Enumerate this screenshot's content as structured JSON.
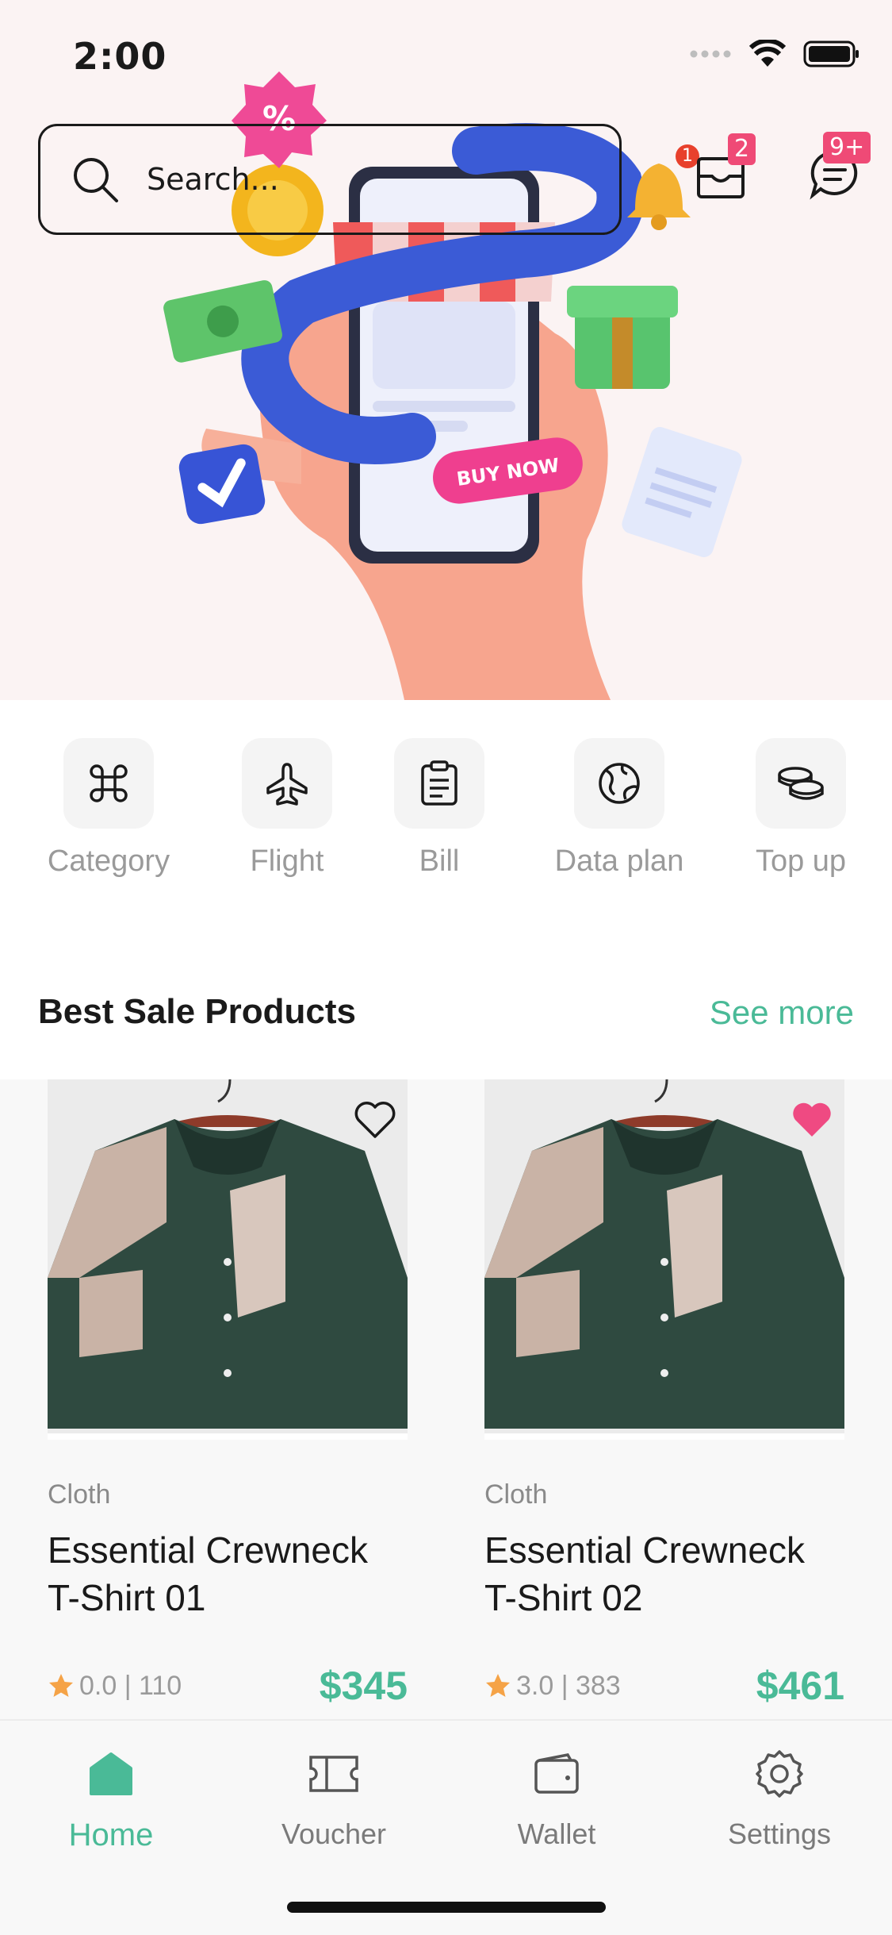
{
  "status_bar": {
    "time": "2:00"
  },
  "search": {
    "placeholder": "Search..."
  },
  "header_badges": {
    "notifications": "1",
    "inbox": "2",
    "messages": "9+"
  },
  "banner": {
    "cta": "BUY NOW",
    "discount_symbol": "%"
  },
  "categories": [
    {
      "label": "Category",
      "icon": "command-icon"
    },
    {
      "label": "Flight",
      "icon": "plane-icon"
    },
    {
      "label": "Bill",
      "icon": "clipboard-icon"
    },
    {
      "label": "Data plan",
      "icon": "globe-icon"
    },
    {
      "label": "Top up",
      "icon": "coins-icon"
    }
  ],
  "best_sale": {
    "title": "Best Sale Products",
    "see_more": "See more"
  },
  "products": [
    {
      "category": "Cloth",
      "title": "Essential Crewneck T-Shirt 01",
      "rating": "0.0 | 110",
      "price": "$345",
      "favorite": false
    },
    {
      "category": "Cloth",
      "title": "Essential Crewneck T-Shirt 02",
      "rating": "3.0 | 383",
      "price": "$461",
      "favorite": true
    }
  ],
  "tabs": [
    {
      "label": "Home",
      "active": true
    },
    {
      "label": "Voucher",
      "active": false
    },
    {
      "label": "Wallet",
      "active": false
    },
    {
      "label": "Settings",
      "active": false
    }
  ],
  "colors": {
    "accent": "#4aba97",
    "badge": "#ef4a76",
    "star": "#f5a347"
  }
}
